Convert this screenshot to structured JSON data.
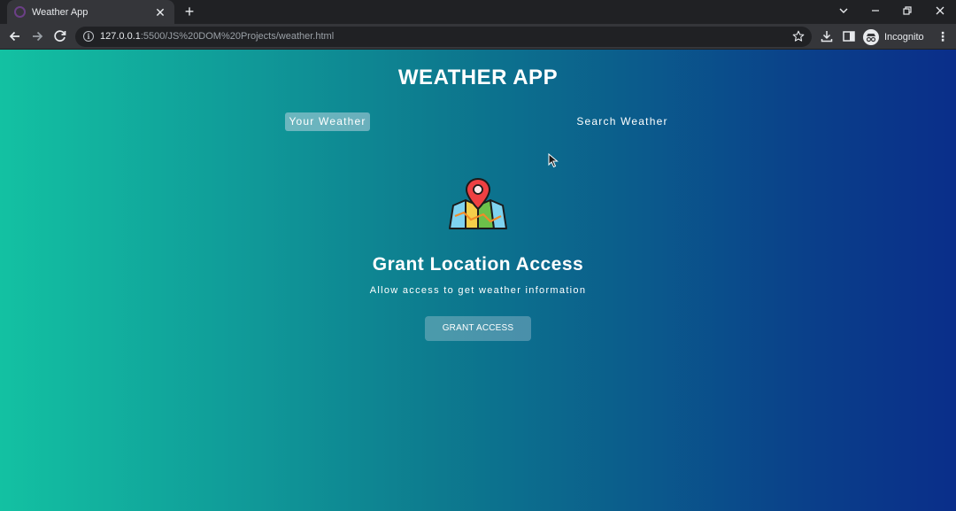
{
  "browser": {
    "tab_title": "Weather App",
    "url_host": "127.0.0.1",
    "url_path": ":5500/JS%20DOM%20Projects/weather.html",
    "profile_label": "Incognito",
    "icons": [
      "favicon-icon",
      "close-icon",
      "plus-icon",
      "chevron-down-icon",
      "minimize-icon",
      "restore-icon",
      "close-window-icon",
      "back-arrow-icon",
      "forward-arrow-icon",
      "reload-icon",
      "info-icon",
      "star-icon",
      "download-icon",
      "side-panel-icon",
      "incognito-icon",
      "kebab-menu-icon"
    ]
  },
  "app": {
    "title": "WEATHER APP",
    "tabs": [
      {
        "label": "Your Weather",
        "active": true
      },
      {
        "label": "Search Weather",
        "active": false
      }
    ],
    "grant": {
      "heading": "Grant Location Access",
      "subtext": "Allow access to get weather information",
      "button_label": "GRANT ACCESS"
    },
    "illustration": "location-map-icon"
  },
  "colors": {
    "gradient_start": "#13c1a2",
    "gradient_end": "#0a2e8a",
    "chrome_dark": "#202124",
    "chrome_toolbar": "#35363a"
  }
}
